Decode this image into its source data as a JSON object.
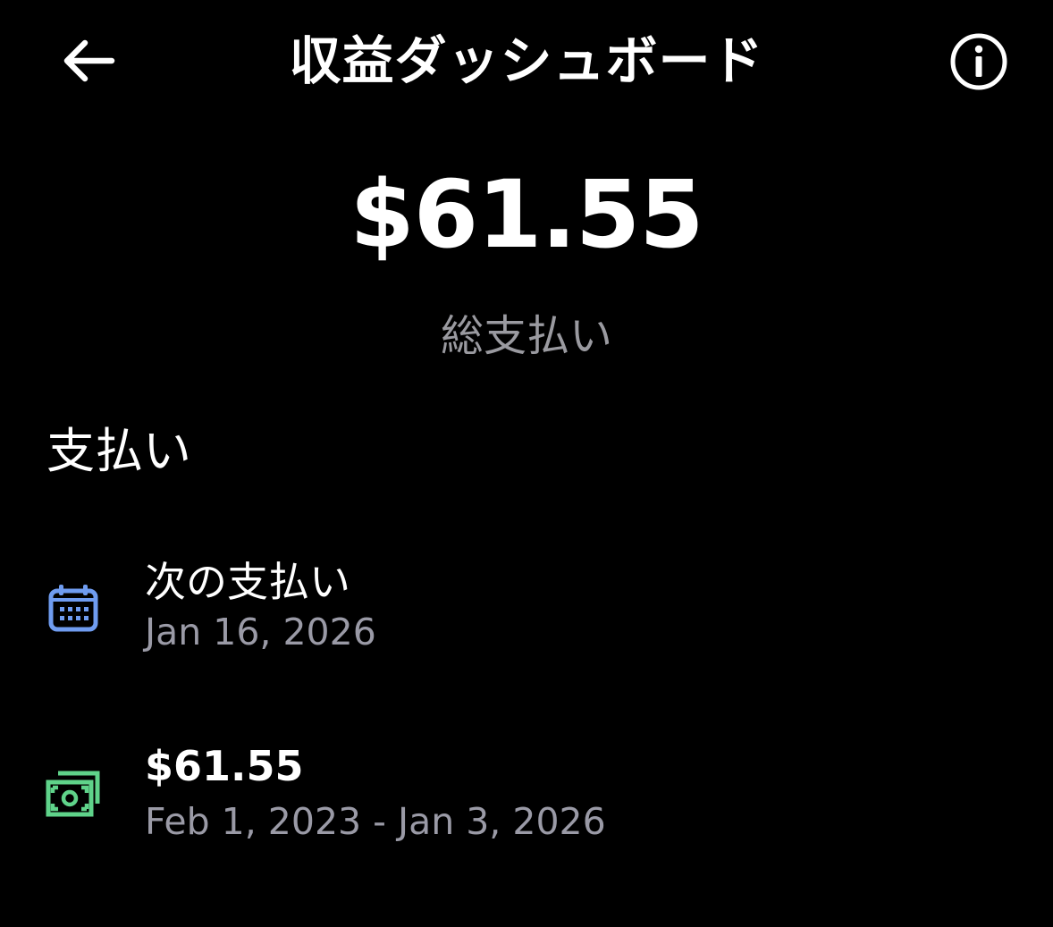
{
  "header": {
    "title": "収益ダッシュボード",
    "back_icon": "arrow-left-icon",
    "info_icon": "info-circle-icon"
  },
  "summary": {
    "total_amount": "$61.55",
    "total_label": "総支払い"
  },
  "payments": {
    "heading": "支払い",
    "rows": [
      {
        "icon": "calendar-icon",
        "icon_color": "#6f9cf0",
        "title": "次の支払い",
        "subtitle": "Jan 16, 2026"
      },
      {
        "icon": "cash-icon",
        "icon_color": "#5fd38a",
        "title": "$61.55",
        "subtitle": "Feb 1, 2023 - Jan 3, 2026"
      }
    ]
  },
  "colors": {
    "background": "#000000",
    "text_primary": "#ffffff",
    "text_secondary": "#9a9aa6"
  }
}
